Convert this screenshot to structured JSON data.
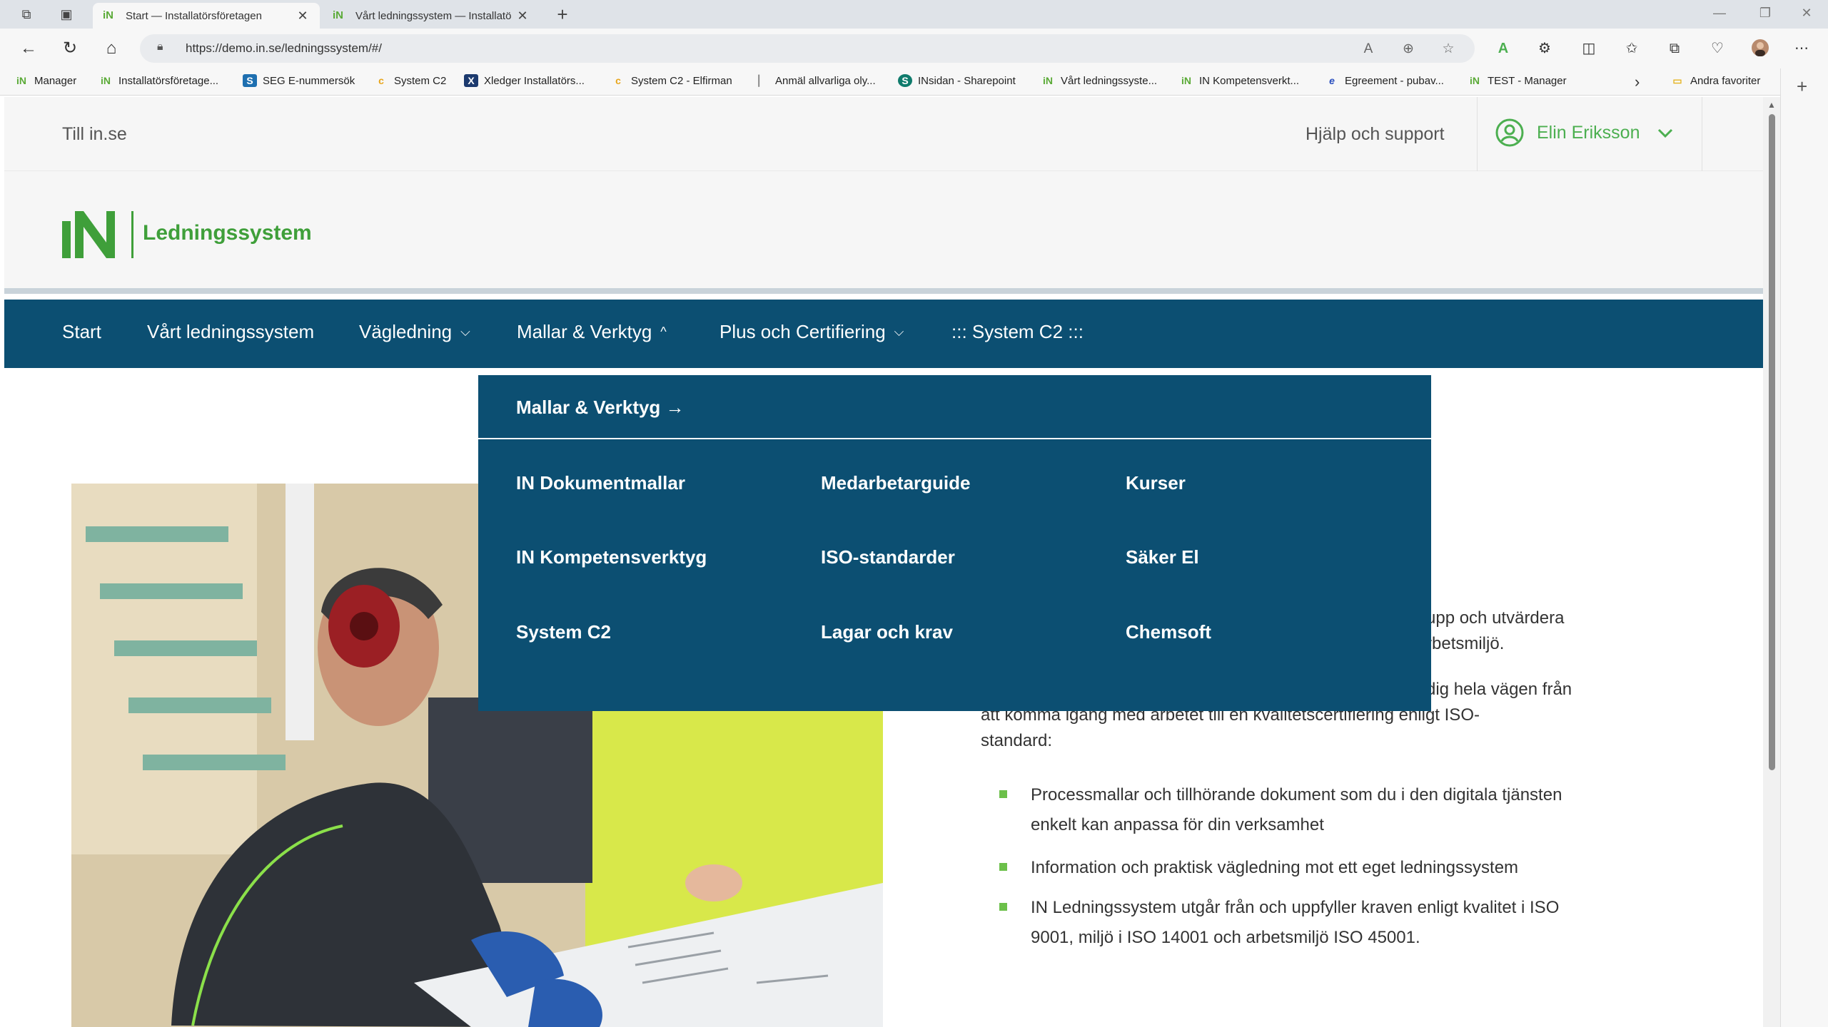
{
  "browser": {
    "tabs": [
      {
        "title": "Start — Installatörsföretagen",
        "active": true
      },
      {
        "title": "Vårt ledningssystem — Installatö",
        "active": false
      }
    ],
    "url": "https://demo.in.se/ledningssystem/#/",
    "bookmarks": [
      {
        "label": "Manager",
        "icon": "in-logo-icon"
      },
      {
        "label": "Installatörsföretage...",
        "icon": "in-logo-icon"
      },
      {
        "label": "SEG E-nummersök",
        "icon": "seg-icon"
      },
      {
        "label": "System C2",
        "icon": "c2-icon"
      },
      {
        "label": "Xledger  Installatörs...",
        "icon": "xledger-icon"
      },
      {
        "label": "System C2 - Elfirman",
        "icon": "c2-icon"
      },
      {
        "label": "Anmäl allvarliga oly...",
        "icon": "doc-icon"
      },
      {
        "label": "INsidan - Sharepoint",
        "icon": "sharepoint-icon"
      },
      {
        "label": "Vårt ledningssyste...",
        "icon": "in-logo-icon"
      },
      {
        "label": "IN Kompetensverkt...",
        "icon": "in-logo-icon"
      },
      {
        "label": "Egreement - pubav...",
        "icon": "e-icon"
      },
      {
        "label": "TEST - Manager",
        "icon": "in-logo-icon"
      }
    ],
    "other_favorites": "Andra favoriter"
  },
  "site": {
    "utility": {
      "back_link": "Till in.se",
      "help": "Hjälp och support",
      "user_name": "Elin Eriksson"
    },
    "brand_name": "Ledningssystem",
    "nav": {
      "start": "Start",
      "system": "Vårt ledningssystem",
      "guidance": "Vägledning",
      "templates": "Mallar & Verktyg",
      "plus": "Plus och Certifiering",
      "c2": "::: System C2 :::"
    },
    "dropdown": {
      "heading": "Mallar & Verktyg →",
      "links": [
        "IN Dokumentmallar",
        "Medarbetarguide",
        "Kurser",
        "IN Kompetensverktyg",
        "ISO-standarder",
        "Säker El",
        "System C2",
        "Lagar och krav",
        "Chemsoft"
      ]
    },
    "content": {
      "p1_line1": "upp och utvärdera",
      "p1_line2": "rbetsmiljö.",
      "p2_line1": "dig hela vägen från",
      "p2_line2": "att komma igång med arbetet till en kvalitetscertifiering enligt ISO-",
      "p2_line3": "standard:",
      "bullets": [
        "Processmallar och tillhörande dokument som du i den digitala tjänsten enkelt kan anpassa för din verksamhet",
        "Information och praktisk vägledning mot ett eget ledningssystem",
        "IN Ledningssystem utgår från och uppfyller kraven enligt kvalitet i ISO 9001, miljö i ISO 14001 och arbetsmiljö ISO 45001."
      ]
    },
    "colors": {
      "nav_bg": "#0c4f72",
      "brand_green": "#3f9f3a",
      "bullet_green": "#6cc04a"
    }
  }
}
